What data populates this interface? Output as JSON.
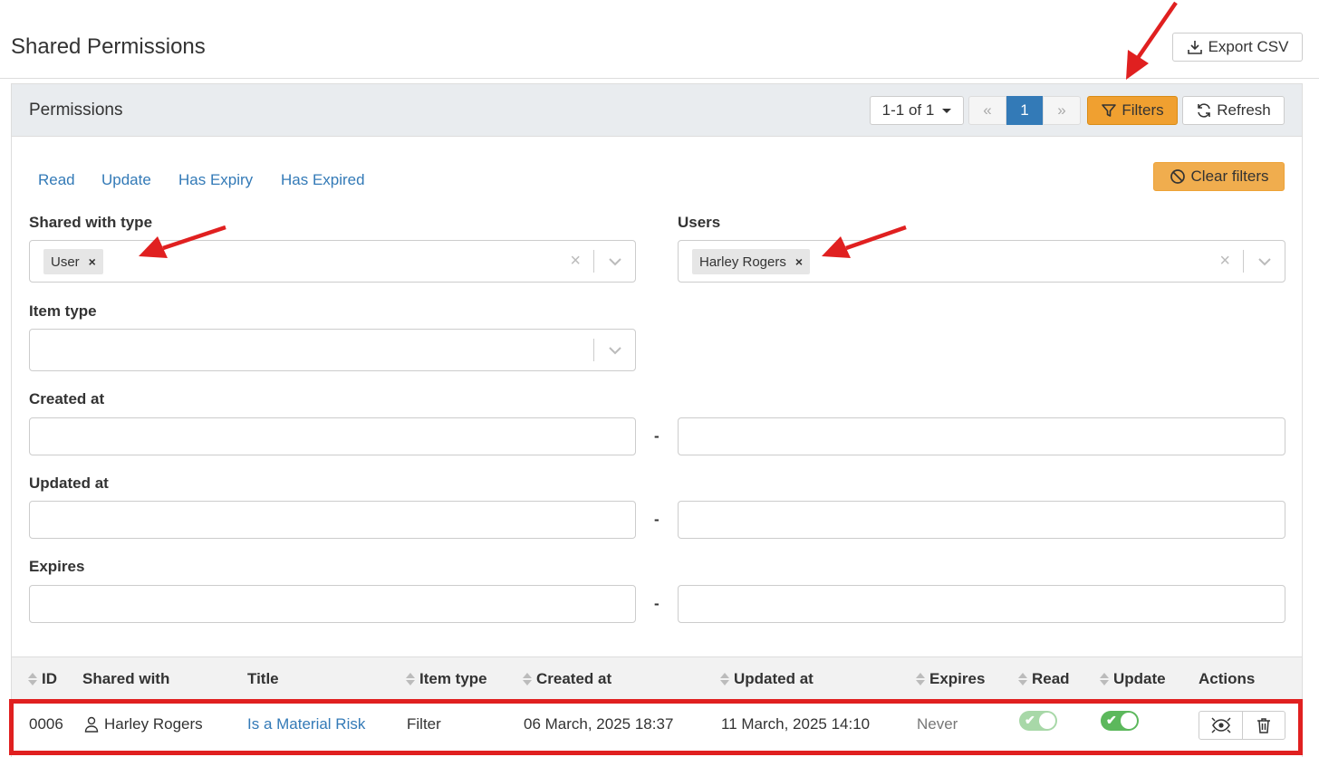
{
  "header": {
    "title": "Shared Permissions",
    "export_label": "Export CSV"
  },
  "panel": {
    "title": "Permissions",
    "pager_count": "1-1 of 1",
    "pages": [
      "«",
      "1",
      "»"
    ],
    "filters_label": "Filters",
    "refresh_label": "Refresh"
  },
  "filters": {
    "quick_links": [
      "Read",
      "Update",
      "Has Expiry",
      "Has Expired"
    ],
    "clear_label": "Clear filters",
    "shared_with_type": {
      "label": "Shared with type",
      "tag": "User"
    },
    "users": {
      "label": "Users",
      "tag": "Harley Rogers"
    },
    "item_type": {
      "label": "Item type"
    },
    "created_at": {
      "label": "Created at"
    },
    "updated_at": {
      "label": "Updated at"
    },
    "expires": {
      "label": "Expires"
    },
    "range_separator": "-"
  },
  "table": {
    "columns": [
      "ID",
      "Shared with",
      "Title",
      "Item type",
      "Created at",
      "Updated at",
      "Expires",
      "Read",
      "Update",
      "Actions"
    ],
    "rows": [
      {
        "id": "0006",
        "shared_with": "Harley Rogers",
        "title": "Is a Material Risk",
        "item_type": "Filter",
        "created_at": "06 March, 2025 18:37",
        "updated_at": "11 March, 2025 14:10",
        "expires": "Never",
        "read": true,
        "update": true
      }
    ]
  },
  "colors": {
    "primary": "#337ab7",
    "filters_button": "#f0a030",
    "clear_button": "#f0ad4e",
    "toggle_on": "#5cb85c",
    "toggle_light": "#a8d8a8",
    "annotation": "#e02020"
  }
}
